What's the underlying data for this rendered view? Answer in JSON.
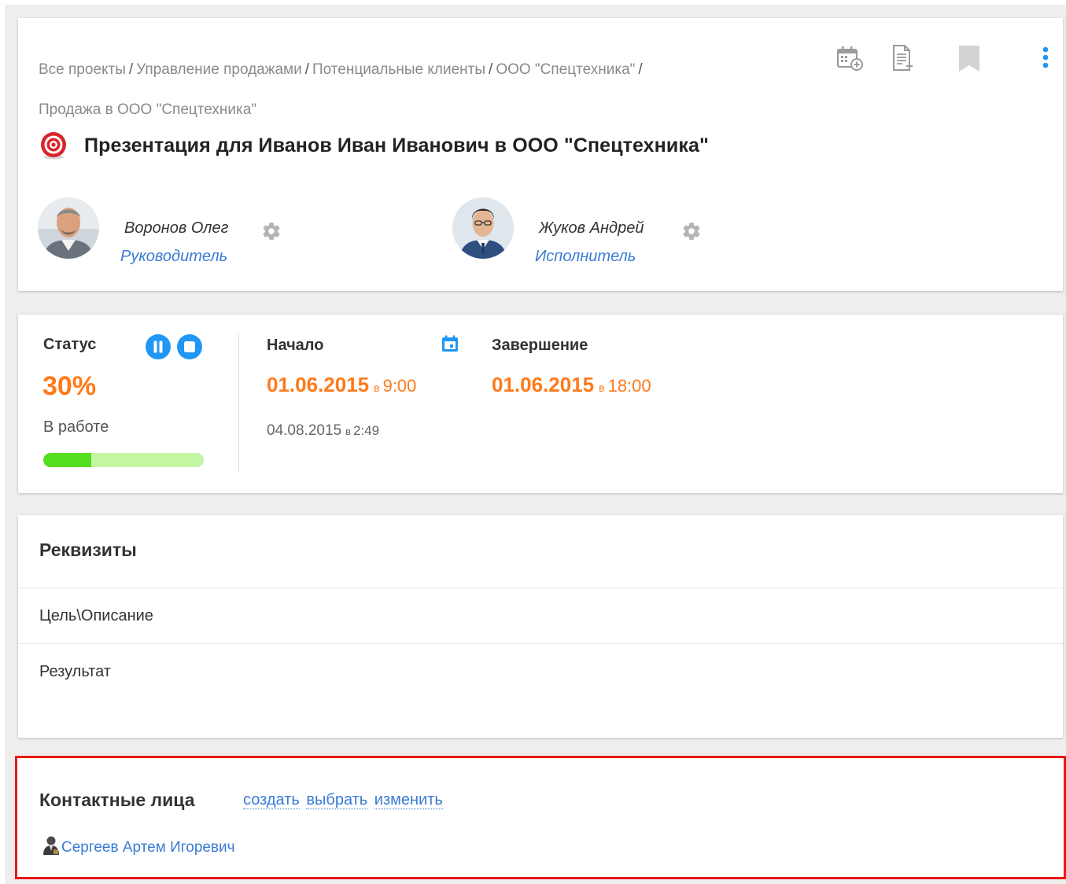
{
  "breadcrumb": {
    "items": [
      "Все проекты",
      "Управление продажами",
      "Потенциальные клиенты",
      "ООО \"Спецтехника\"",
      "Продажа в ООО \"Спецтехника\""
    ],
    "separator": "/"
  },
  "toolbar": {
    "icons": [
      "calendar-add-icon",
      "document-add-icon",
      "bookmark-icon",
      "more-vertical-icon"
    ]
  },
  "task": {
    "icon": "target-icon",
    "title": "Презентация для Иванов Иван Иванович в ООО \"Спецтехника\""
  },
  "people": [
    {
      "name": "Воронов Олег",
      "role": "Руководитель"
    },
    {
      "name": "Жуков Андрей",
      "role": "Исполнитель"
    }
  ],
  "status": {
    "label": "Статус",
    "percent_text": "30%",
    "progress": 0.3,
    "state": "В работе",
    "controls": [
      "pause-icon",
      "stop-icon"
    ]
  },
  "dates": {
    "start_label": "Начало",
    "end_label": "Завершение",
    "start_date": "01.06.2015",
    "start_at": "в",
    "start_time": "9:00",
    "end_date": "01.06.2015",
    "end_at": "в",
    "end_time": "18:00",
    "actual_date": "04.08.2015",
    "actual_at": "в",
    "actual_time": "2:49"
  },
  "requisites": {
    "title": "Реквизиты",
    "fields": [
      "Цель\\Описание",
      "Результат"
    ]
  },
  "contacts": {
    "title": "Контактные лица",
    "actions": [
      "создать",
      "выбрать",
      "изменить"
    ],
    "items": [
      "Сергеев Артем Игоревич"
    ]
  },
  "colors": {
    "accent_orange": "#ff7a1a",
    "link_blue": "#3a7bd5",
    "button_blue": "#2196f3",
    "progress_fill": "#55dd1f",
    "progress_track": "#c4f5a2",
    "highlight_border": "#e81818"
  }
}
